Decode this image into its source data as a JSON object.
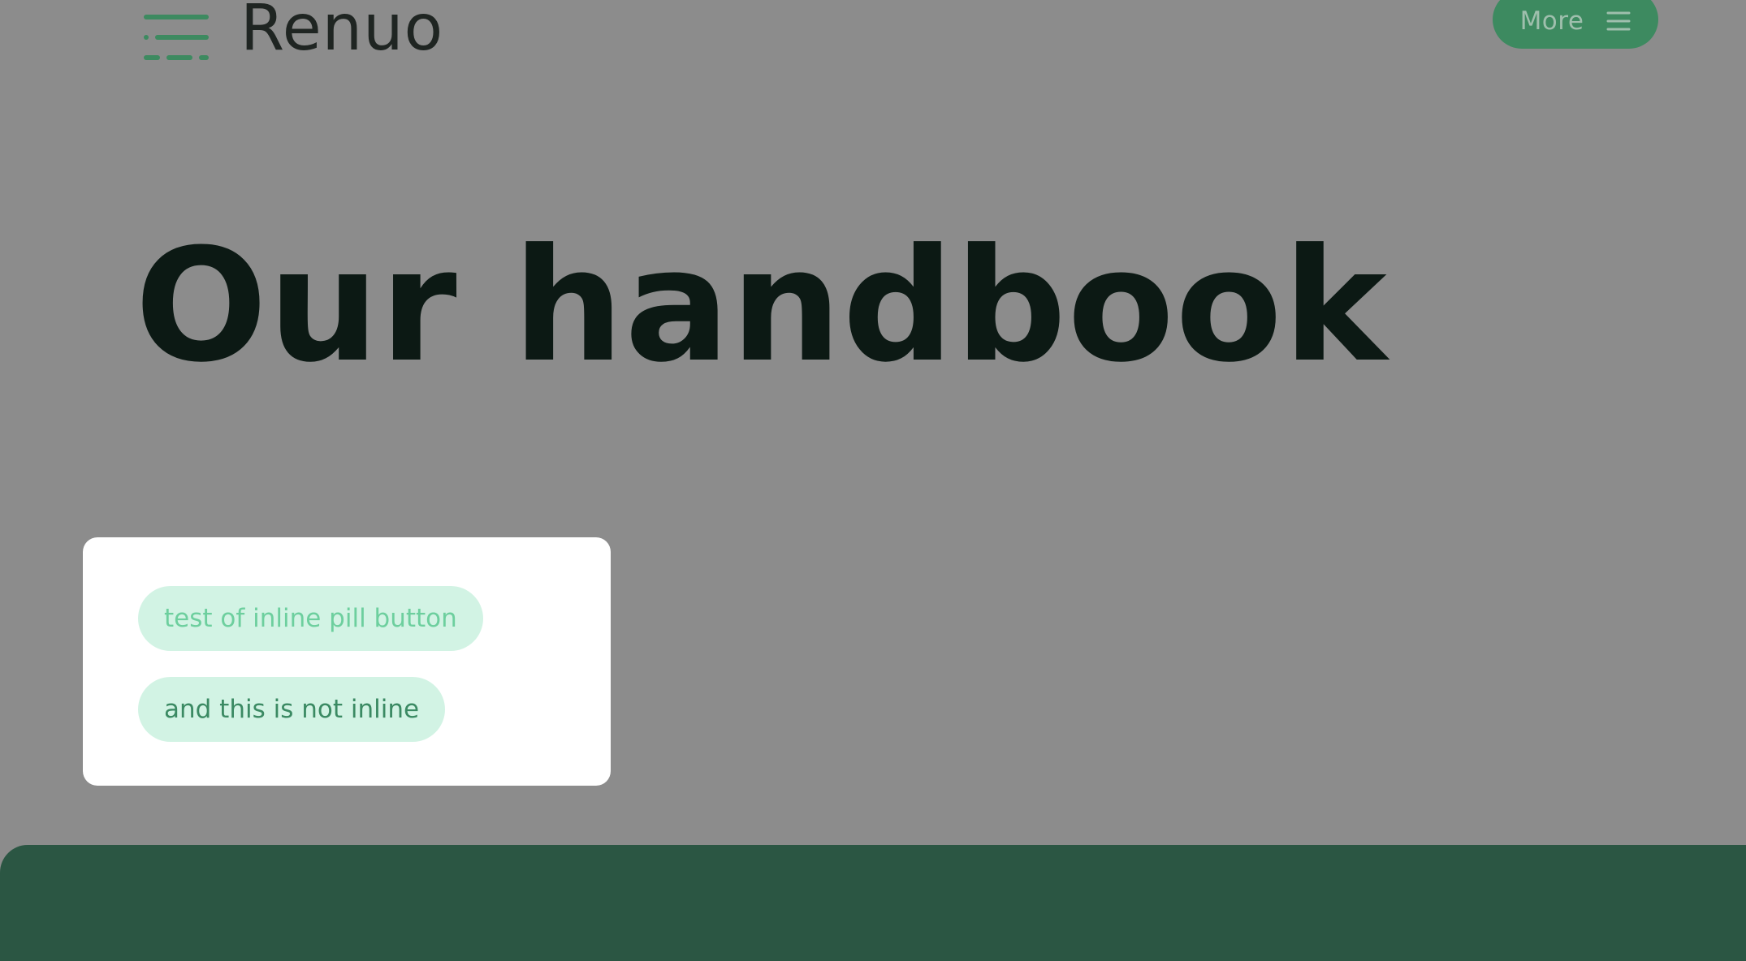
{
  "header": {
    "logo": {
      "icon": "renuo-logo-icon",
      "text": "Renuo"
    },
    "menu_button": {
      "label": "More",
      "icon": "hamburger-menu-icon"
    }
  },
  "hero": {
    "title": "Our handbook"
  },
  "card": {
    "pills": [
      {
        "label": "test of inline pill button"
      },
      {
        "label": "and this is not inline"
      }
    ]
  },
  "colors": {
    "page_background": "#8c8c8c",
    "brand_green": "#3d8a60",
    "pill_background": "#d2f3e4",
    "footer_band": "#2b5643",
    "title_text": "#0c1914"
  }
}
